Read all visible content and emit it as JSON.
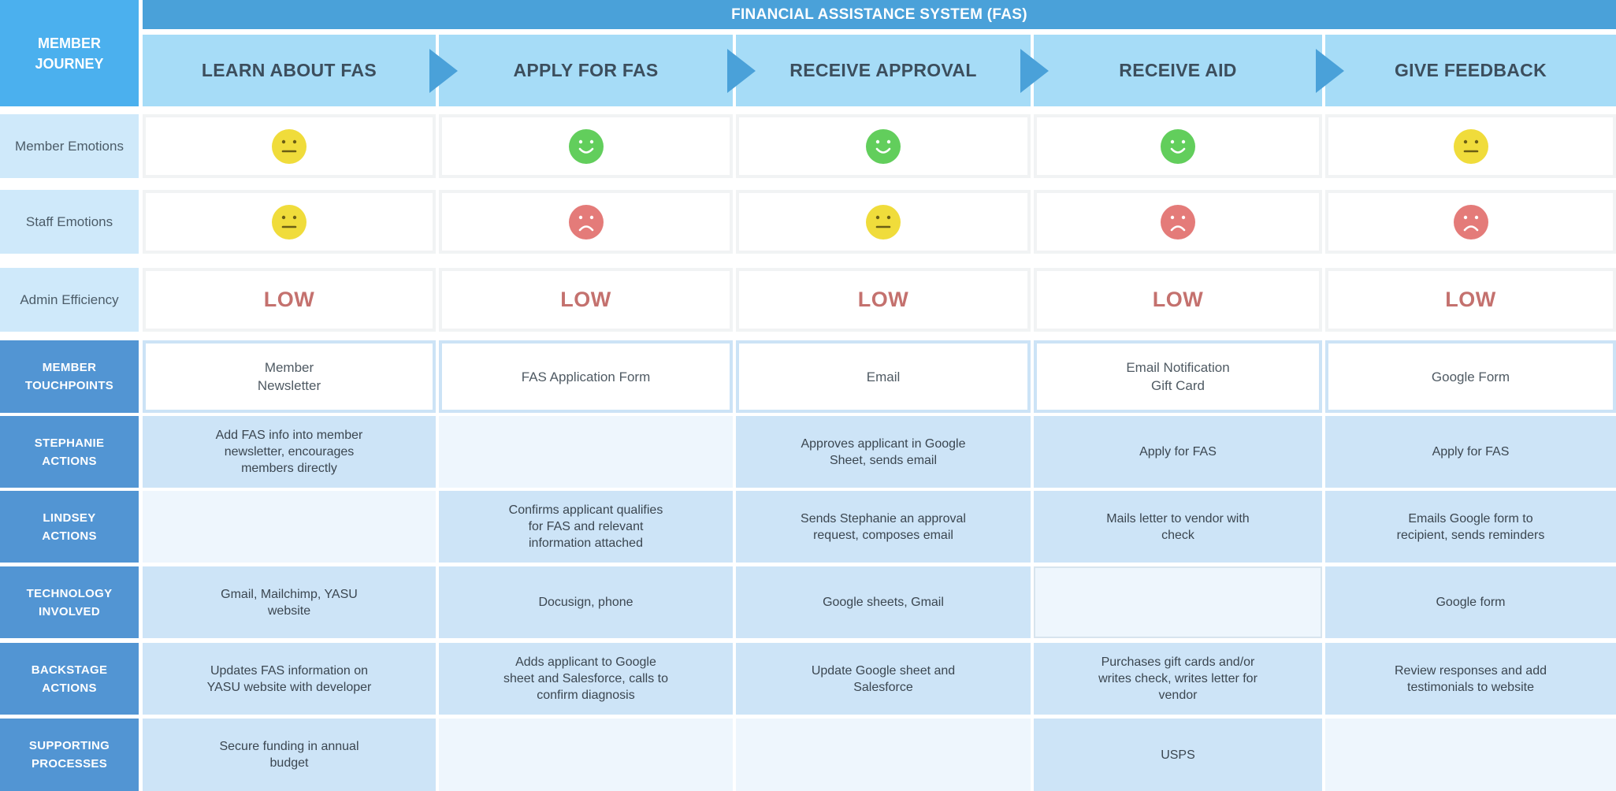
{
  "title": "FINANCIAL ASSISTANCE SYSTEM (FAS)",
  "member_journey_label": "MEMBER\nJOURNEY",
  "stages": [
    "LEARN ABOUT FAS",
    "APPLY FOR FAS",
    "RECEIVE APPROVAL",
    "RECEIVE AID",
    "GIVE FEEDBACK"
  ],
  "colors": {
    "face_neutral": "#f0dc3b",
    "face_happy": "#62ce5c",
    "face_sad": "#e47b79"
  },
  "rows": {
    "member_emotions": {
      "label": "Member Emotions",
      "values": [
        "neutral",
        "happy",
        "happy",
        "happy",
        "neutral"
      ]
    },
    "staff_emotions": {
      "label": "Staff Emotions",
      "values": [
        "neutral",
        "sad",
        "neutral",
        "sad",
        "sad"
      ]
    },
    "admin_efficiency": {
      "label": "Admin Efficiency",
      "values": [
        "LOW",
        "LOW",
        "LOW",
        "LOW",
        "LOW"
      ]
    },
    "member_touchpoints": {
      "label": "MEMBER\nTOUCHPOINTS",
      "values": [
        "Member\nNewsletter",
        "FAS Application Form",
        "Email",
        "Email Notification\nGift Card",
        "Google Form"
      ]
    },
    "stephanie_actions": {
      "label": "STEPHANIE\nACTIONS",
      "values": [
        "Add FAS info into member\nnewsletter, encourages\nmembers directly",
        "",
        "Approves applicant in Google\nSheet, sends email",
        "Apply for FAS",
        "Apply for FAS"
      ]
    },
    "lindsey_actions": {
      "label": "LINDSEY\nACTIONS",
      "values": [
        "",
        "Confirms applicant qualifies\nfor FAS and relevant\ninformation attached",
        "Sends Stephanie an approval\nrequest, composes email",
        "Mails letter to vendor with\ncheck",
        "Emails Google form to\nrecipient, sends reminders"
      ]
    },
    "technology_involved": {
      "label": "TECHNOLOGY\nINVOLVED",
      "values": [
        "Gmail, Mailchimp, YASU\nwebsite",
        "Docusign, phone",
        "Google sheets, Gmail",
        "",
        "Google form"
      ]
    },
    "backstage_actions": {
      "label": "BACKSTAGE\nACTIONS",
      "values": [
        "Updates FAS information on\nYASU website with developer",
        "Adds applicant to Google\nsheet and Salesforce, calls to\nconfirm diagnosis",
        "Update Google sheet and\nSalesforce",
        "Purchases gift cards and/or\nwrites check, writes letter for\nvendor",
        "Review responses and add\ntestimonials to website"
      ]
    },
    "supporting_processes": {
      "label": "SUPPORTING\nPROCESSES",
      "values": [
        "Secure funding in annual\nbudget",
        "",
        "",
        "USPS",
        ""
      ]
    }
  }
}
